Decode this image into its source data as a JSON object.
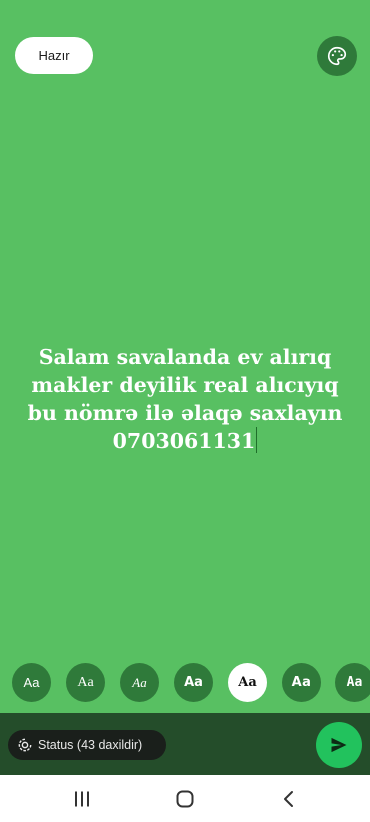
{
  "header": {
    "done_label": "Hazır",
    "palette_icon": "palette-icon"
  },
  "message": {
    "lines": [
      "Salam savalanda ev alırıq",
      "makler deyilik real alıcıyıq",
      "bu nömrə ilə əlaqə saxlayın",
      "0703061131"
    ]
  },
  "font_options": [
    {
      "label": "Aa",
      "selected": false
    },
    {
      "label": "Aa",
      "selected": false
    },
    {
      "label": "Aa",
      "selected": false
    },
    {
      "label": "Aa",
      "selected": false
    },
    {
      "label": "Aa",
      "selected": true
    },
    {
      "label": "Aa",
      "selected": false
    },
    {
      "label": "Aa",
      "selected": false
    }
  ],
  "footer": {
    "status_label": "Status (43 daxildir)",
    "send_icon": "send-icon"
  },
  "colors": {
    "background": "#58c062",
    "accent": "#22c25d",
    "dark_green": "#2f7a3a"
  },
  "nav": {
    "recents_icon": "recents-icon",
    "home_icon": "home-icon",
    "back_icon": "back-icon"
  }
}
